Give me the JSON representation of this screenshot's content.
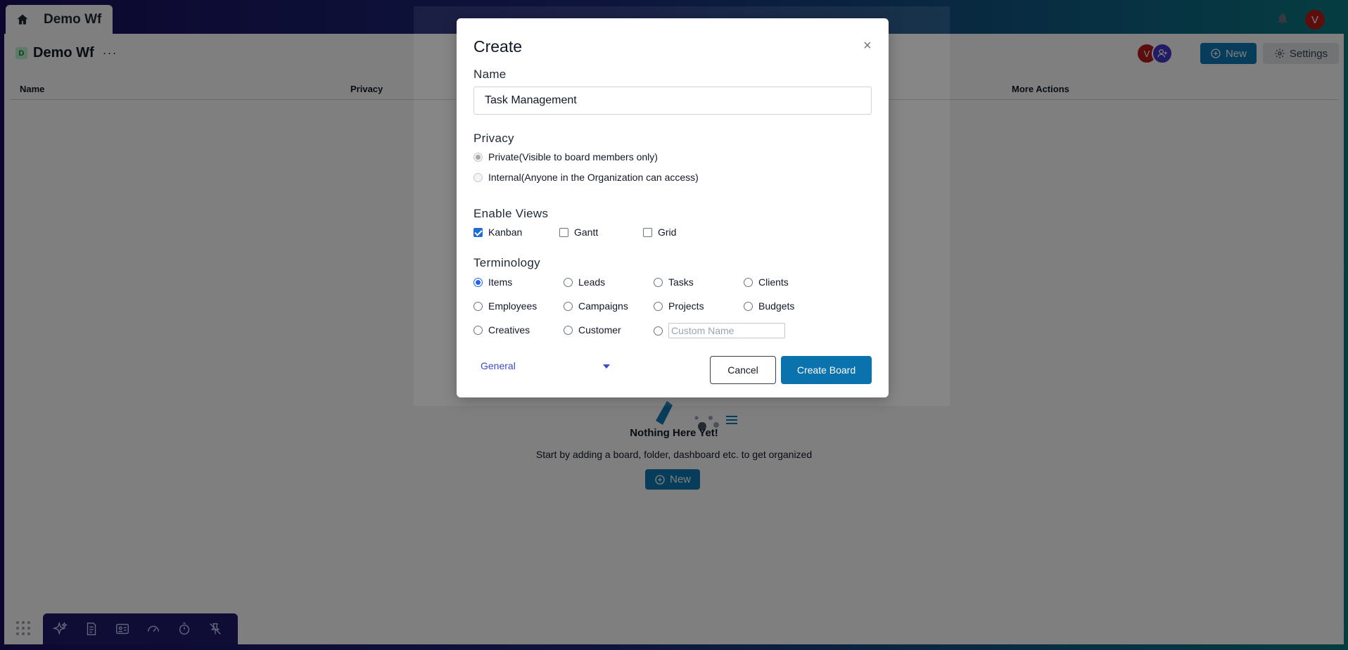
{
  "topbar": {
    "home_tab_title": "Demo Wf",
    "user_initial": "V"
  },
  "workspace": {
    "title": "Demo Wf",
    "badge": "D",
    "more": "···",
    "avatar_initial": "V",
    "new_label": "New",
    "settings_label": "Settings",
    "columns": [
      "Name",
      "Privacy",
      "More Actions"
    ],
    "empty_title": "Nothing Here Yet!",
    "empty_subtitle": "Start by adding a board, folder, dashboard etc. to get organized",
    "empty_new_label": "New"
  },
  "modal": {
    "title": "Create",
    "close": "×",
    "name_label": "Name",
    "name_value": "Task Management",
    "privacy_label": "Privacy",
    "privacy_options": [
      {
        "label": "Private(Visible to board members only)",
        "selected": true,
        "disabled": true
      },
      {
        "label": "Internal(Anyone in the Organization can access)",
        "selected": false,
        "disabled": true
      }
    ],
    "views_label": "Enable Views",
    "views": [
      {
        "label": "Kanban",
        "checked": true
      },
      {
        "label": "Gantt",
        "checked": false
      },
      {
        "label": "Grid",
        "checked": false
      }
    ],
    "terminology_label": "Terminology",
    "terminology": [
      {
        "label": "Items",
        "selected": true
      },
      {
        "label": "Leads",
        "selected": false
      },
      {
        "label": "Tasks",
        "selected": false
      },
      {
        "label": "Clients",
        "selected": false
      },
      {
        "label": "Employees",
        "selected": false
      },
      {
        "label": "Campaigns",
        "selected": false
      },
      {
        "label": "Projects",
        "selected": false
      },
      {
        "label": "Budgets",
        "selected": false
      },
      {
        "label": "Creatives",
        "selected": false
      },
      {
        "label": "Customer",
        "selected": false
      }
    ],
    "custom_name_placeholder": "Custom Name",
    "template_select": "General",
    "cancel_label": "Cancel",
    "create_label": "Create Board"
  },
  "colors": {
    "primary": "#0a73ad",
    "select_text": "#3b4bc8",
    "checkbox": "#1d6fd6"
  }
}
